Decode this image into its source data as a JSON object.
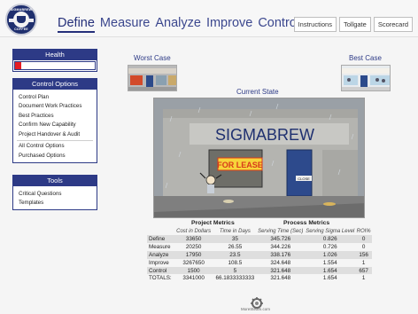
{
  "header": {
    "logo_text_top": "SIGMABREW",
    "logo_text_bottom": "COFFEE",
    "nav": [
      {
        "label": "Define",
        "active": true
      },
      {
        "label": "Measure",
        "active": false
      },
      {
        "label": "Analyze",
        "active": false
      },
      {
        "label": "Improve",
        "active": false
      },
      {
        "label": "Control",
        "active": false
      }
    ],
    "buttons": [
      "Instructions",
      "Tollgate",
      "Scorecard"
    ]
  },
  "sidebar": {
    "health": {
      "title": "Health",
      "level_percent": 8,
      "color": "#e51c23"
    },
    "control_options": {
      "title": "Control Options",
      "group1": [
        "Control Plan",
        "Document Work Practices",
        "Best Practices",
        "Confirm New Capability",
        "Project Handover & Audit"
      ],
      "group2": [
        "All Control Options",
        "Purchased Options"
      ]
    },
    "tools": {
      "title": "Tools",
      "items": [
        "Critical Questions",
        "Templates"
      ]
    }
  },
  "main": {
    "worst_case_label": "Worst Case",
    "best_case_label": "Best Case",
    "current_state_label": "Current State",
    "scene": {
      "sign": "SIGMABREW",
      "window_sign": "FOR LEASE",
      "door_sign": "CLOSE"
    }
  },
  "metrics": {
    "project_title": "Project Metrics",
    "process_title": "Process Metrics",
    "columns": [
      "",
      "Cost in Dollars",
      "Time in Days",
      "Serving Time (Sec)",
      "Serving Sigma Level",
      "ROI%"
    ],
    "rows": [
      {
        "phase": "Define",
        "cost": "33650",
        "time": "35",
        "serving_time": "345.726",
        "sigma": "0.826",
        "roi": "0"
      },
      {
        "phase": "Measure",
        "cost": "20250",
        "time": "26.55",
        "serving_time": "344.226",
        "sigma": "0.726",
        "roi": "0"
      },
      {
        "phase": "Analyze",
        "cost": "17950",
        "time": "23.5",
        "serving_time": "338.176",
        "sigma": "1.026",
        "roi": "156"
      },
      {
        "phase": "Improve",
        "cost": "3267650",
        "time": "108.5",
        "serving_time": "324.648",
        "sigma": "1.554",
        "roi": "1"
      },
      {
        "phase": "Control",
        "cost": "1500",
        "time": "5",
        "serving_time": "321.648",
        "sigma": "1.654",
        "roi": "657"
      },
      {
        "phase": "TOTALS:",
        "cost": "3341000",
        "time": "66.1833333333",
        "serving_time": "321.648",
        "sigma": "1.654",
        "roi": "1"
      }
    ]
  },
  "footer": {
    "brand": "MoreSteam.com"
  }
}
